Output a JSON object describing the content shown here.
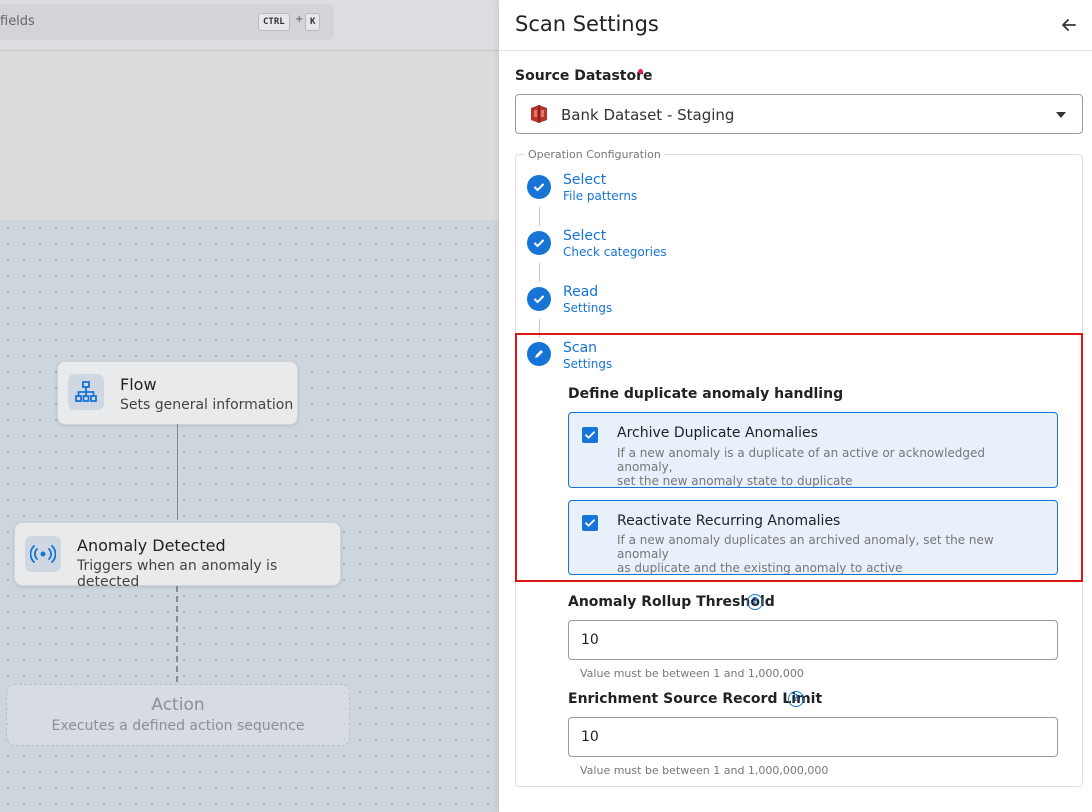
{
  "topbar": {
    "search_text": "fields",
    "kbd_ctrl": "CTRL",
    "kbd_plus": "+",
    "kbd_k": "K"
  },
  "canvas": {
    "flow": {
      "title": "Flow",
      "subtitle": "Sets general information",
      "icon": "sitemap-icon"
    },
    "trigger": {
      "title": "Anomaly Detected",
      "subtitle": "Triggers when an anomaly is detected",
      "icon": "broadcast-icon"
    },
    "action": {
      "title": "Action",
      "subtitle": "Executes a defined action sequence"
    }
  },
  "panel": {
    "title": "Scan Settings",
    "source_label": "Source Datastore",
    "source_value": "Bank Dataset - Staging",
    "fieldset_legend": "Operation Configuration",
    "steps": [
      {
        "title": "Select",
        "subtitle": "File patterns",
        "state": "done"
      },
      {
        "title": "Select",
        "subtitle": "Check categories",
        "state": "done"
      },
      {
        "title": "Read",
        "subtitle": "Settings",
        "state": "done"
      },
      {
        "title": "Scan",
        "subtitle": "Settings",
        "state": "editing"
      }
    ],
    "dup_heading": "Define duplicate anomaly handling",
    "options": [
      {
        "title": "Archive Duplicate Anomalies",
        "desc_line1": "If a new anomaly is a duplicate of an active or acknowledged anomaly,",
        "desc_line2": "set the new anomaly state to duplicate",
        "checked": true
      },
      {
        "title": "Reactivate Recurring Anomalies",
        "desc_line1": "If a new anomaly duplicates an archived anomaly, set the new anomaly",
        "desc_line2": "as duplicate and the existing anomaly to active",
        "checked": true
      }
    ],
    "rollup_label": "Anomaly Rollup Threshold",
    "rollup_value": "10",
    "rollup_hint": "Value must be between 1 and 1,000,000",
    "enrich_label": "Enrichment Source Record Limit",
    "enrich_value": "10",
    "enrich_hint": "Value must be between 1 and 1,000,000,000",
    "help_glyph": "?"
  },
  "colors": {
    "accent": "#1674d6",
    "highlight": "#e01515",
    "required": "#e0245e"
  }
}
